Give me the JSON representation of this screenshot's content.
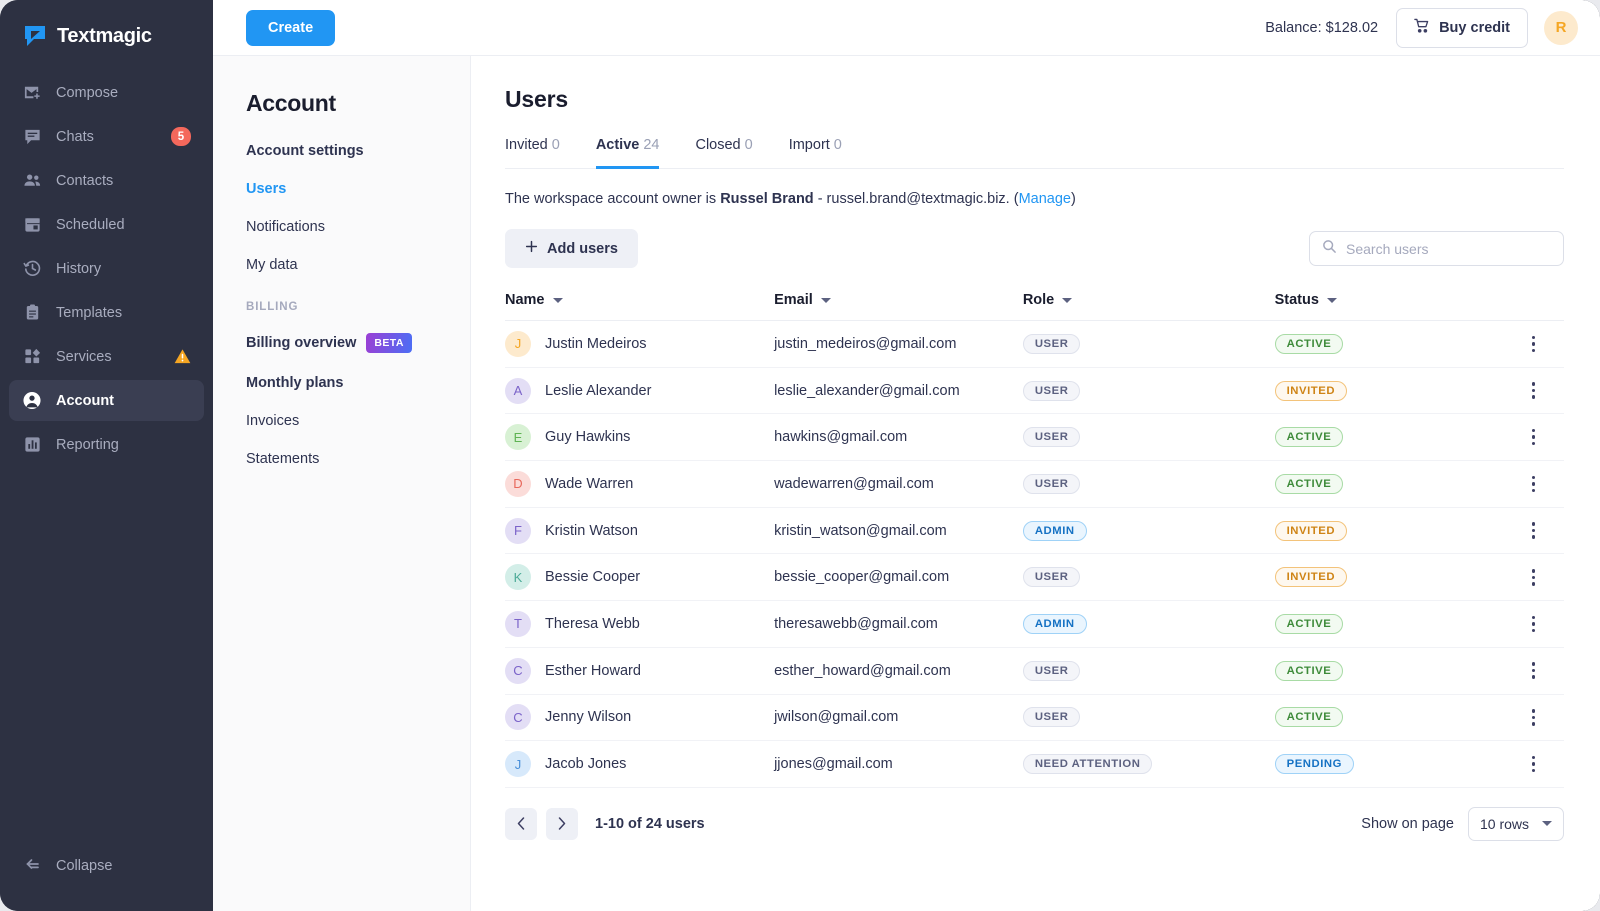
{
  "brand": {
    "name": "Textmagic",
    "logo_icon": "textmagic-logo-icon"
  },
  "sidebar": {
    "items": [
      {
        "label": "Compose",
        "icon": "compose-mail-icon"
      },
      {
        "label": "Chats",
        "icon": "chat-bubble-icon",
        "badge": "5"
      },
      {
        "label": "Contacts",
        "icon": "contacts-people-icon"
      },
      {
        "label": "Scheduled",
        "icon": "calendar-icon"
      },
      {
        "label": "History",
        "icon": "clock-history-icon"
      },
      {
        "label": "Templates",
        "icon": "clipboard-icon"
      },
      {
        "label": "Services",
        "icon": "services-grid-icon",
        "warning": true
      },
      {
        "label": "Account",
        "icon": "account-person-icon",
        "active": true
      },
      {
        "label": "Reporting",
        "icon": "reporting-chart-icon"
      }
    ],
    "collapse": {
      "label": "Collapse",
      "icon": "collapse-arrow-icon"
    },
    "badge_color": "#f4685c",
    "warning_color": "#f5a623"
  },
  "topbar": {
    "create_label": "Create",
    "create_color": "#2196f3",
    "balance_label": "Balance: $128.02",
    "buy_credit_label": "Buy credit",
    "cart_icon": "shopping-cart-icon",
    "avatar_initial": "R"
  },
  "account_panel": {
    "title": "Account",
    "items": [
      {
        "label": "Account settings",
        "bold": true
      },
      {
        "label": "Users",
        "current": true
      },
      {
        "label": "Notifications"
      },
      {
        "label": "My data"
      }
    ],
    "section_label": "BILLING",
    "billing_items": [
      {
        "label": "Billing overview",
        "bold": true,
        "badge": "BETA"
      },
      {
        "label": "Monthly plans",
        "bold": true
      },
      {
        "label": "Invoices"
      },
      {
        "label": "Statements"
      }
    ]
  },
  "main": {
    "page_title": "Users",
    "tabs": [
      {
        "label": "Invited",
        "count": "0",
        "active": false
      },
      {
        "label": "Active",
        "count": "24",
        "active": true
      },
      {
        "label": "Closed",
        "count": "0",
        "active": false
      },
      {
        "label": "Import",
        "count": "0",
        "active": false
      }
    ],
    "owner_notice": {
      "prefix": "The workspace account owner is ",
      "owner_name": "Russel Brand",
      "middle": " - russel.brand@textmagic.biz. (",
      "manage_link": "Manage",
      "suffix": ")"
    },
    "add_users_label": "Add users",
    "add_users_icon": "plus-icon",
    "search": {
      "placeholder": "Search users",
      "value": "",
      "icon": "search-icon"
    },
    "table": {
      "columns": [
        "Name",
        "Email",
        "Role",
        "Status"
      ],
      "rows": [
        {
          "avatar": "J",
          "avatar_bg": "#fdeacd",
          "avatar_fg": "#f5a623",
          "name": "Justin Medeiros",
          "email": "justin_medeiros@gmail.com",
          "role": "USER",
          "role_style": "user",
          "status": "ACTIVE",
          "status_style": "active"
        },
        {
          "avatar": "A",
          "avatar_bg": "#e3def5",
          "avatar_fg": "#7b63c9",
          "name": "Leslie Alexander",
          "email": "leslie_alexander@gmail.com",
          "role": "USER",
          "role_style": "user",
          "status": "INVITED",
          "status_style": "invited"
        },
        {
          "avatar": "E",
          "avatar_bg": "#d8f1d4",
          "avatar_fg": "#5fb354",
          "name": "Guy Hawkins",
          "email": "hawkins@gmail.com",
          "role": "USER",
          "role_style": "user",
          "status": "ACTIVE",
          "status_style": "active"
        },
        {
          "avatar": "D",
          "avatar_bg": "#fbdcd9",
          "avatar_fg": "#e8685c",
          "name": "Wade Warren",
          "email": "wadewarren@gmail.com",
          "role": "USER",
          "role_style": "user",
          "status": "ACTIVE",
          "status_style": "active"
        },
        {
          "avatar": "F",
          "avatar_bg": "#e3def5",
          "avatar_fg": "#7b63c9",
          "name": "Kristin Watson",
          "email": "kristin_watson@gmail.com",
          "role": "ADMIN",
          "role_style": "admin",
          "status": "INVITED",
          "status_style": "invited"
        },
        {
          "avatar": "K",
          "avatar_bg": "#d3eee8",
          "avatar_fg": "#4dab98",
          "name": "Bessie Cooper",
          "email": "bessie_cooper@gmail.com",
          "role": "USER",
          "role_style": "user",
          "status": "INVITED",
          "status_style": "invited"
        },
        {
          "avatar": "T",
          "avatar_bg": "#e3def5",
          "avatar_fg": "#7b63c9",
          "name": "Theresa Webb",
          "email": "theresawebb@gmail.com",
          "role": "ADMIN",
          "role_style": "admin",
          "status": "ACTIVE",
          "status_style": "active"
        },
        {
          "avatar": "C",
          "avatar_bg": "#e3def5",
          "avatar_fg": "#7b63c9",
          "name": "Esther Howard",
          "email": "esther_howard@gmail.com",
          "role": "USER",
          "role_style": "user",
          "status": "ACTIVE",
          "status_style": "active"
        },
        {
          "avatar": "C",
          "avatar_bg": "#e3def5",
          "avatar_fg": "#7b63c9",
          "name": "Jenny Wilson",
          "email": "jwilson@gmail.com",
          "role": "USER",
          "role_style": "user",
          "status": "ACTIVE",
          "status_style": "active"
        },
        {
          "avatar": "J",
          "avatar_bg": "#d7e9fb",
          "avatar_fg": "#4a90d9",
          "name": "Jacob Jones",
          "email": "jjones@gmail.com",
          "role": "NEED ATTENTION",
          "role_style": "needatt",
          "status": "PENDING",
          "status_style": "pending"
        }
      ]
    },
    "pagination": {
      "prev_icon": "chevron-left-icon",
      "next_icon": "chevron-right-icon",
      "info": "1-10 of 24 users",
      "show_on_page_label": "Show on page",
      "rows_value": "10 rows"
    }
  }
}
